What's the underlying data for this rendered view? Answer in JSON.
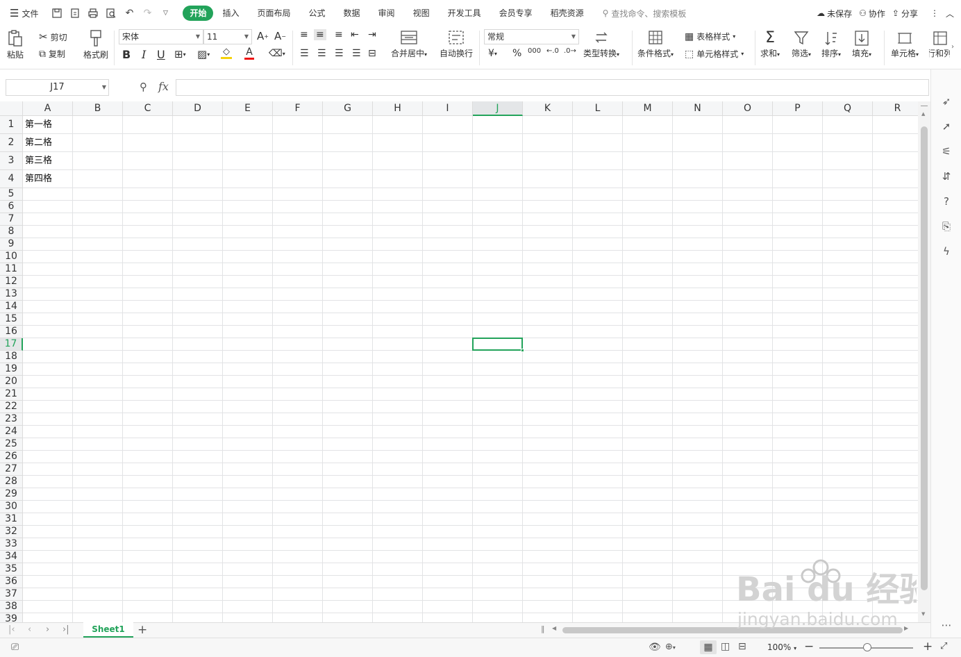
{
  "menu": {
    "file_label": "文件"
  },
  "tabs": [
    "开始",
    "插入",
    "页面布局",
    "公式",
    "数据",
    "审阅",
    "视图",
    "开发工具",
    "会员专享",
    "稻壳资源"
  ],
  "active_tab": "开始",
  "search_placeholder": "查找命令、搜索模板",
  "top_right": {
    "unsaved": "未保存",
    "collab": "协作",
    "share": "分享"
  },
  "ribbon": {
    "paste": "粘贴",
    "cut": "剪切",
    "copy": "复制",
    "format_painter": "格式刷",
    "font_name": "宋体",
    "font_size": "11",
    "bold": "B",
    "italic": "I",
    "underline": "U",
    "merge_center": "合并居中",
    "wrap_text": "自动换行",
    "number_format": "常规",
    "currency": "¥",
    "percent": "%",
    "thousands": "000",
    "type_convert": "类型转换",
    "cond_format": "条件格式",
    "table_style": "表格样式",
    "cell_style": "单元格样式",
    "sum": "求和",
    "filter": "筛选",
    "sort": "排序",
    "fill": "填充",
    "cell": "单元格",
    "row_col": "行和列"
  },
  "formula_bar": {
    "name_box": "J17",
    "fx": "fx",
    "value": ""
  },
  "columns": [
    "A",
    "B",
    "C",
    "D",
    "E",
    "F",
    "G",
    "H",
    "I",
    "J",
    "K",
    "L",
    "M",
    "N",
    "O",
    "P",
    "Q",
    "R"
  ],
  "selected_column": "J",
  "rows": [
    "1",
    "2",
    "3",
    "4",
    "5",
    "6",
    "7",
    "8",
    "9",
    "10",
    "11",
    "12",
    "13",
    "14",
    "15",
    "16",
    "17",
    "18",
    "19",
    "20",
    "21",
    "22",
    "23",
    "24",
    "25",
    "26",
    "27",
    "28",
    "29",
    "30",
    "31",
    "32",
    "33",
    "34",
    "35",
    "36",
    "37",
    "38",
    "39"
  ],
  "selected_row": "17",
  "cells": {
    "A1": "第一格",
    "A2": "第二格",
    "A3": "第三格",
    "A4": "第四格"
  },
  "sheets": [
    "Sheet1"
  ],
  "active_sheet": "Sheet1",
  "status": {
    "zoom": "100%"
  },
  "watermark": {
    "brand": "Bai  du 经验",
    "url": "jingyan.baidu.com"
  },
  "colors": {
    "accent": "#22a35a",
    "grid": "#e2e3e5",
    "header_bg": "#f5f6f7"
  }
}
